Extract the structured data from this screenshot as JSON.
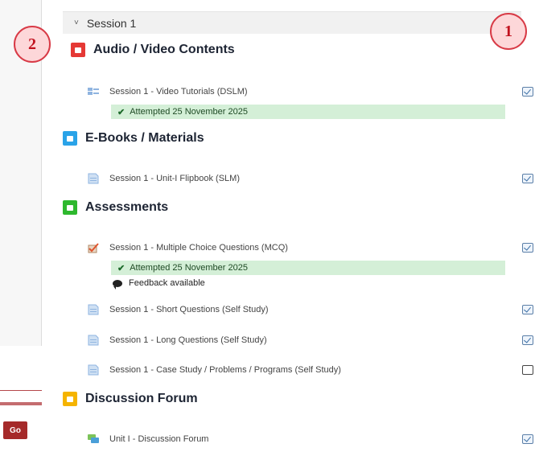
{
  "sidebar": {
    "go_label": "Go"
  },
  "session": {
    "chevron": "˅",
    "title": "Session 1"
  },
  "sections": {
    "audio_video": {
      "title": "Audio / Video Contents",
      "icon": "film-icon",
      "color": "#e53935"
    },
    "ebooks": {
      "title": "E-Books / Materials",
      "icon": "book-icon",
      "color": "#2aa3e8"
    },
    "assessments": {
      "title": "Assessments",
      "icon": "clipboard-icon",
      "color": "#2eb82e"
    },
    "forum": {
      "title": "Discussion Forum",
      "icon": "chat-icon",
      "color": "#f5b400"
    }
  },
  "activities": {
    "video_tutorials": {
      "name": "Session 1 - Video Tutorials (DSLM)",
      "completion": "checked"
    },
    "video_attempted": "Attempted 25 November 2025",
    "flipbook": {
      "name": "Session 1 - Unit-I Flipbook (SLM)",
      "completion": "checked"
    },
    "mcq": {
      "name": "Session 1 - Multiple Choice Questions (MCQ)",
      "completion": "checked"
    },
    "mcq_attempted": "Attempted 25 November 2025",
    "mcq_feedback": "Feedback available",
    "short_q": {
      "name": "Session 1 - Short Questions (Self Study)",
      "completion": "checked"
    },
    "long_q": {
      "name": "Session 1 - Long Questions (Self Study)",
      "completion": "checked"
    },
    "case_study": {
      "name": "Session 1 - Case Study / Problems / Programs (Self Study)",
      "completion": "empty"
    },
    "forum_unit": {
      "name": "Unit I - Discussion Forum",
      "completion": "checked"
    }
  },
  "callouts": {
    "one": "1",
    "two": "2"
  }
}
